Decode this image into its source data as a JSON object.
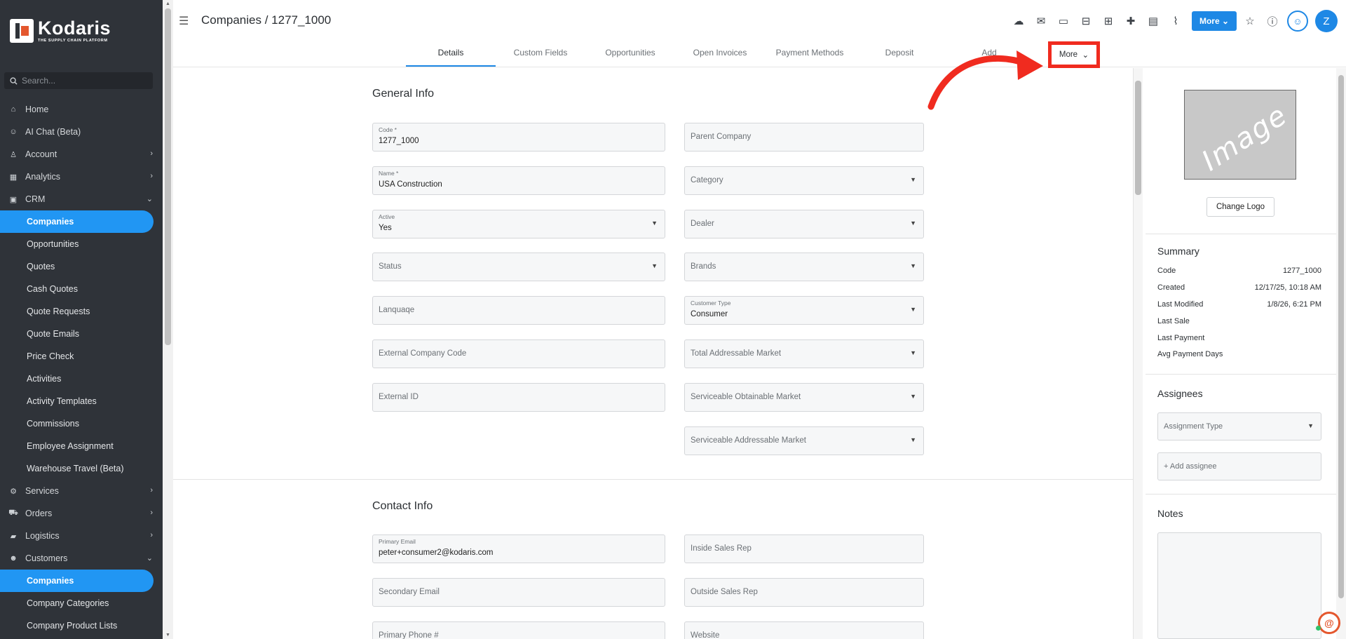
{
  "brand": {
    "name": "Kodaris",
    "tagline": "THE SUPPLY CHAIN PLATFORM"
  },
  "sidebar": {
    "search_placeholder": "Search...",
    "items": [
      {
        "label": "Home",
        "icon": "home-icon"
      },
      {
        "label": "AI Chat (Beta)",
        "icon": "robot-icon"
      },
      {
        "label": "Account",
        "icon": "user-icon"
      },
      {
        "label": "Analytics",
        "icon": "analytics-icon"
      },
      {
        "label": "CRM",
        "icon": "crm-icon"
      },
      {
        "label": "Companies"
      },
      {
        "label": "Opportunities"
      },
      {
        "label": "Quotes"
      },
      {
        "label": "Cash Quotes"
      },
      {
        "label": "Quote Requests"
      },
      {
        "label": "Quote Emails"
      },
      {
        "label": "Price Check"
      },
      {
        "label": "Activities"
      },
      {
        "label": "Activity Templates"
      },
      {
        "label": "Commissions"
      },
      {
        "label": "Employee Assignment"
      },
      {
        "label": "Warehouse Travel (Beta)"
      },
      {
        "label": "Services",
        "icon": "services-icon"
      },
      {
        "label": "Orders",
        "icon": "orders-icon"
      },
      {
        "label": "Logistics",
        "icon": "truck-icon"
      },
      {
        "label": "Customers",
        "icon": "customers-icon"
      },
      {
        "label": "Companies"
      },
      {
        "label": "Company Categories"
      },
      {
        "label": "Company Product Lists"
      }
    ]
  },
  "header": {
    "title": "Companies / 1277_1000",
    "more_button": "More",
    "avatar_initial": "Z"
  },
  "tabs": [
    "Details",
    "Custom Fields",
    "Opportunities",
    "Open Invoices",
    "Payment Methods",
    "Deposit",
    "Add"
  ],
  "tab_more": "More",
  "general_info": {
    "title": "General Info",
    "code_label": "Code *",
    "code_value": "1277_1000",
    "name_label": "Name *",
    "name_value": "USA Construction",
    "active_label": "Active",
    "active_value": "Yes",
    "status_placeholder": "Status",
    "language_placeholder": "Lanquaqe",
    "external_company_code_placeholder": "External Company Code",
    "external_id_placeholder": "External ID",
    "parent_company_placeholder": "Parent Company",
    "category_placeholder": "Category",
    "dealer_placeholder": "Dealer",
    "brands_placeholder": "Brands",
    "customer_type_label": "Customer Type",
    "customer_type_value": "Consumer",
    "tam_placeholder": "Total Addressable Market",
    "som_placeholder": "Serviceable Obtainable Market",
    "sam_placeholder": "Serviceable Addressable Market"
  },
  "contact_info": {
    "title": "Contact Info",
    "primary_email_label": "Primary Email",
    "primary_email_value": "peter+consumer2@kodaris.com",
    "secondary_email_placeholder": "Secondary Email",
    "primary_phone_placeholder": "Primary Phone #",
    "inside_sales_rep_placeholder": "Inside Sales Rep",
    "outside_sales_rep_placeholder": "Outside Sales Rep",
    "website_placeholder": "Website"
  },
  "right_panel": {
    "image_placeholder": "Image",
    "change_logo": "Change Logo",
    "summary_title": "Summary",
    "summary": [
      {
        "label": "Code",
        "value": "1277_1000"
      },
      {
        "label": "Created",
        "value": "12/17/25, 10:18 AM"
      },
      {
        "label": "Last Modified",
        "value": "1/8/26, 6:21 PM"
      },
      {
        "label": "Last Sale",
        "value": ""
      },
      {
        "label": "Last Payment",
        "value": ""
      },
      {
        "label": "Avg Payment Days",
        "value": ""
      }
    ],
    "assignees_title": "Assignees",
    "assignment_type_placeholder": "Assignment Type",
    "add_assignee": "+ Add assignee",
    "notes_title": "Notes"
  },
  "colors": {
    "accent": "#1e88e5",
    "sidebar_bg": "#2f3339",
    "highlight": "#f02b1f"
  }
}
